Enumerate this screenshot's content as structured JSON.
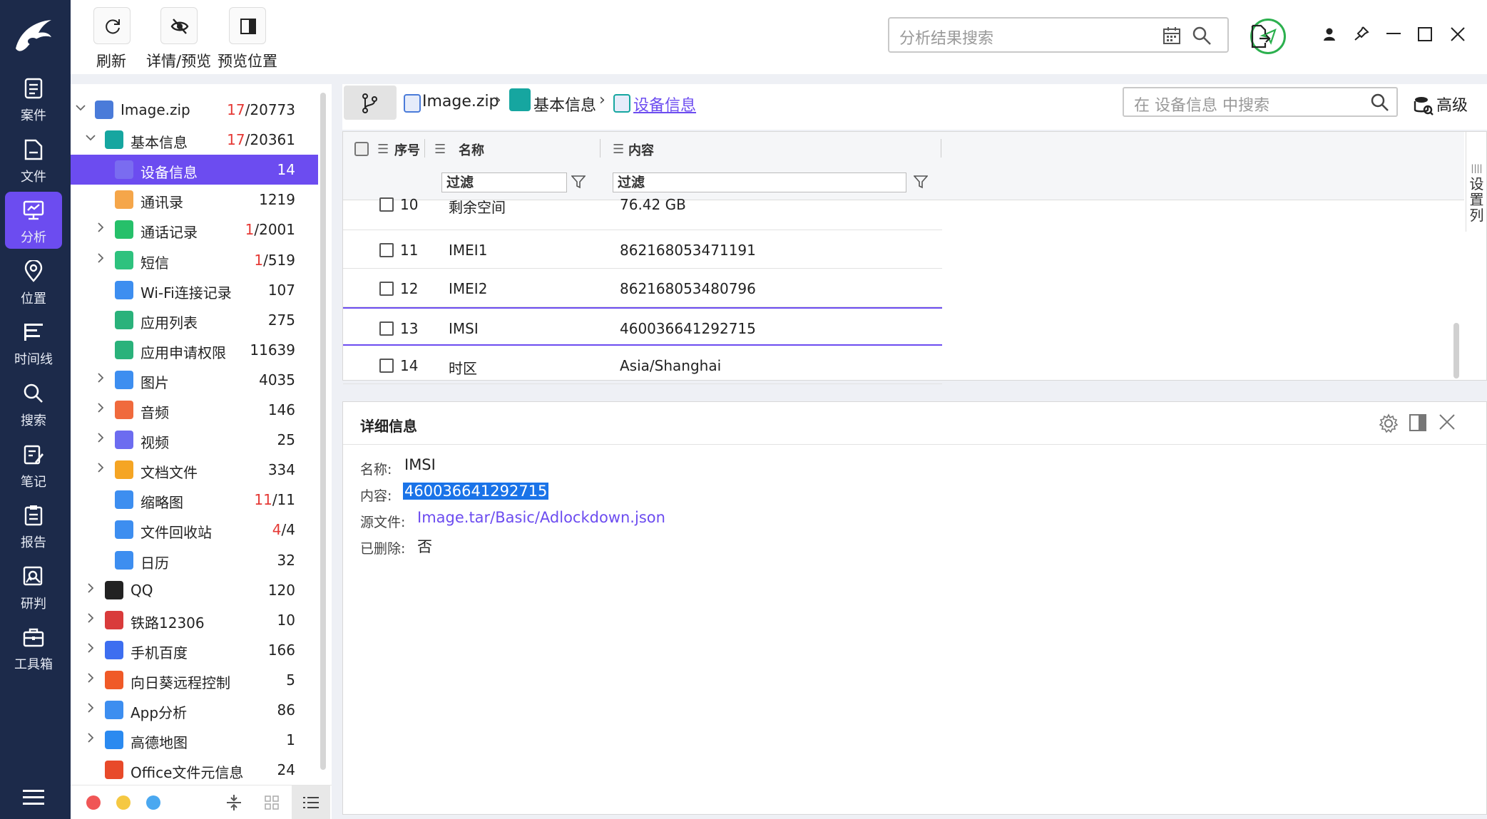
{
  "nav": {
    "items": [
      {
        "label": "案件",
        "icon": "case-icon"
      },
      {
        "label": "文件",
        "icon": "file-icon"
      },
      {
        "label": "分析",
        "icon": "analysis-icon"
      },
      {
        "label": "位置",
        "icon": "location-icon"
      },
      {
        "label": "时间线",
        "icon": "timeline-icon"
      },
      {
        "label": "搜索",
        "icon": "search-icon"
      },
      {
        "label": "笔记",
        "icon": "note-icon"
      },
      {
        "label": "报告",
        "icon": "report-icon"
      },
      {
        "label": "研判",
        "icon": "judge-icon"
      },
      {
        "label": "工具箱",
        "icon": "toolbox-icon"
      }
    ],
    "active": "分析"
  },
  "toolbar": {
    "refresh_label": "刷新",
    "detail_preview_label": "详情/预览",
    "preview_position_label": "预览位置",
    "search_placeholder": "分析结果搜索"
  },
  "tree": [
    {
      "label": "Image.zip",
      "red": "17",
      "count": "/20773",
      "level": 0,
      "arrow": "down",
      "icon_color": "#4a7bd9"
    },
    {
      "label": "基本信息",
      "red": "17",
      "count": "/20361",
      "level": 1,
      "arrow": "down",
      "icon_color": "#16a6a0"
    },
    {
      "label": "设备信息",
      "red": "",
      "count": "14",
      "level": 2,
      "arrow": "",
      "icon_color": "#7a6cf0"
    },
    {
      "label": "通讯录",
      "red": "",
      "count": "1219",
      "level": 2,
      "arrow": "",
      "icon_color": "#f5a64a"
    },
    {
      "label": "通话记录",
      "red": "1",
      "count": "/2001",
      "level": 2,
      "arrow": "right",
      "icon_color": "#26c06a"
    },
    {
      "label": "短信",
      "red": "1",
      "count": "/519",
      "level": 2,
      "arrow": "right",
      "icon_color": "#2ec27e"
    },
    {
      "label": "Wi-Fi连接记录",
      "red": "",
      "count": "107",
      "level": 2,
      "arrow": "",
      "icon_color": "#3d8ef0"
    },
    {
      "label": "应用列表",
      "red": "",
      "count": "275",
      "level": 2,
      "arrow": "",
      "icon_color": "#2ab27b"
    },
    {
      "label": "应用申请权限",
      "red": "",
      "count": "11639",
      "level": 2,
      "arrow": "",
      "icon_color": "#2ab27b"
    },
    {
      "label": "图片",
      "red": "",
      "count": "4035",
      "level": 2,
      "arrow": "right",
      "icon_color": "#3d8ef0"
    },
    {
      "label": "音频",
      "red": "",
      "count": "146",
      "level": 2,
      "arrow": "right",
      "icon_color": "#f06a3d"
    },
    {
      "label": "视频",
      "red": "",
      "count": "25",
      "level": 2,
      "arrow": "right",
      "icon_color": "#6c6cf0"
    },
    {
      "label": "文档文件",
      "red": "",
      "count": "334",
      "level": 2,
      "arrow": "right",
      "icon_color": "#f5a524"
    },
    {
      "label": "缩略图",
      "red": "11",
      "count": "/11",
      "level": 2,
      "arrow": "",
      "icon_color": "#3d8ef0"
    },
    {
      "label": "文件回收站",
      "red": "4",
      "count": "/4",
      "level": 2,
      "arrow": "",
      "icon_color": "#3d8ef0"
    },
    {
      "label": "日历",
      "red": "",
      "count": "32",
      "level": 2,
      "arrow": "",
      "icon_color": "#3d8ef0"
    },
    {
      "label": "QQ",
      "red": "",
      "count": "120",
      "level": 1,
      "arrow": "right",
      "icon_color": "#222222"
    },
    {
      "label": "铁路12306",
      "red": "",
      "count": "10",
      "level": 1,
      "arrow": "right",
      "icon_color": "#d93b3b"
    },
    {
      "label": "手机百度",
      "red": "",
      "count": "166",
      "level": 1,
      "arrow": "right",
      "icon_color": "#3d6ef0"
    },
    {
      "label": "向日葵远程控制",
      "red": "",
      "count": "5",
      "level": 1,
      "arrow": "right",
      "icon_color": "#f05a28"
    },
    {
      "label": "App分析",
      "red": "",
      "count": "86",
      "level": 1,
      "arrow": "right",
      "icon_color": "#3d8ef0"
    },
    {
      "label": "高德地图",
      "red": "",
      "count": "1",
      "level": 1,
      "arrow": "right",
      "icon_color": "#2b8af0"
    },
    {
      "label": "Office文件元信息",
      "red": "",
      "count": "24",
      "level": 1,
      "arrow": "",
      "icon_color": "#e84a2a"
    }
  ],
  "breadcrumb": {
    "root": "Image.zip",
    "category": "基本信息",
    "current": "设备信息",
    "search_placeholder": "在 设备信息 中搜索",
    "advanced_label": "高级"
  },
  "grid": {
    "columns": {
      "index": "序号",
      "name": "名称",
      "content": "内容"
    },
    "filter_placeholder": "过滤",
    "settings_label": "设置列",
    "rows": [
      {
        "index": "10",
        "name": "剩余空间",
        "content": "76.42 GB"
      },
      {
        "index": "11",
        "name": "IMEI1",
        "content": "862168053471191"
      },
      {
        "index": "12",
        "name": "IMEI2",
        "content": "862168053480796"
      },
      {
        "index": "13",
        "name": "IMSI",
        "content": "460036641292715"
      },
      {
        "index": "14",
        "name": "时区",
        "content": "Asia/Shanghai"
      }
    ],
    "selected_index": "13"
  },
  "detail": {
    "title": "详细信息",
    "name_label": "名称:",
    "name_value": "IMSI",
    "content_label": "内容:",
    "content_value": "460036641292715",
    "source_label": "源文件:",
    "source_value": "Image.tar/Basic/Adlockdown.json",
    "deleted_label": "已删除:",
    "deleted_value": "否"
  },
  "colors": {
    "accent": "#6c4cf0",
    "rail": "#1c2a4a",
    "red_count": "#e53935",
    "send": "#2cb04e"
  }
}
